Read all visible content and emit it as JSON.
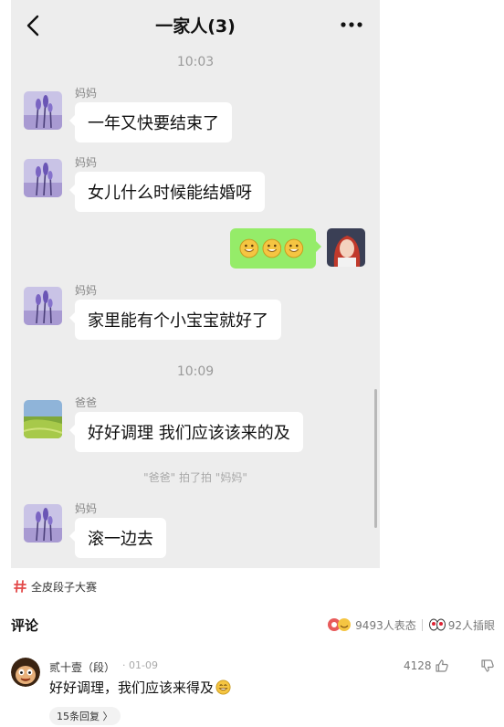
{
  "chat": {
    "title": "一家人(3)",
    "time_1": "10:03",
    "time_2": "10:09",
    "messages": [
      {
        "sender": "妈妈",
        "text": "一年又快要结束了"
      },
      {
        "sender": "妈妈",
        "text": "女儿什么时候能结婚呀"
      },
      {
        "sender": "",
        "text": "",
        "emoji": [
          "smiley-icon",
          "smiley-icon",
          "smiley-icon"
        ]
      },
      {
        "sender": "妈妈",
        "text": "家里能有个小宝宝就好了"
      },
      {
        "sender": "爸爸",
        "text": "好好调理 我们应该该来的及"
      },
      {
        "sender": "妈妈",
        "text": "滚一边去"
      }
    ],
    "system_note": "\"爸爸\" 拍了拍 \"妈妈\"",
    "colors": {
      "background": "#ededed",
      "bubble": "#ffffff",
      "my_bubble": "#95ec69"
    }
  },
  "topic": {
    "icon": "hash-icon",
    "label": "全皮段子大赛"
  },
  "comments": {
    "title": "评论",
    "reactions_label": "9493人表态",
    "saw_label": "92人插眼",
    "items": [
      {
        "user": "贰十壹（段）",
        "date": "· 01-09",
        "likes": "4128",
        "text": "好好调理，我们应该来得及",
        "replies_label": "15条回复 〉"
      }
    ]
  },
  "accent": "#e34a4a"
}
